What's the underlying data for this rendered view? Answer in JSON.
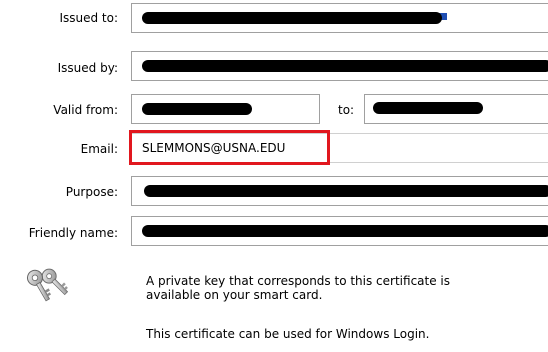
{
  "fields": {
    "issued_to": {
      "label": "Issued to:"
    },
    "issued_by": {
      "label": "Issued by:"
    },
    "valid_from": {
      "label": "Valid from:"
    },
    "valid_to": {
      "label": "to:"
    },
    "email": {
      "label": "Email:",
      "value": "SLEMMONS@USNA.EDU"
    },
    "purpose": {
      "label": "Purpose:"
    },
    "friendly_name": {
      "label": "Friendly name:"
    }
  },
  "info": {
    "key_line1": "A private key that corresponds to this certificate is",
    "key_line2": "available on your smart card.",
    "usage": "This certificate can be used for Windows Login."
  },
  "colors": {
    "highlight": "#e1171e",
    "redaction": "#000000",
    "field_border": "#a0a0a0"
  },
  "icons": {
    "key": "keys-icon"
  }
}
